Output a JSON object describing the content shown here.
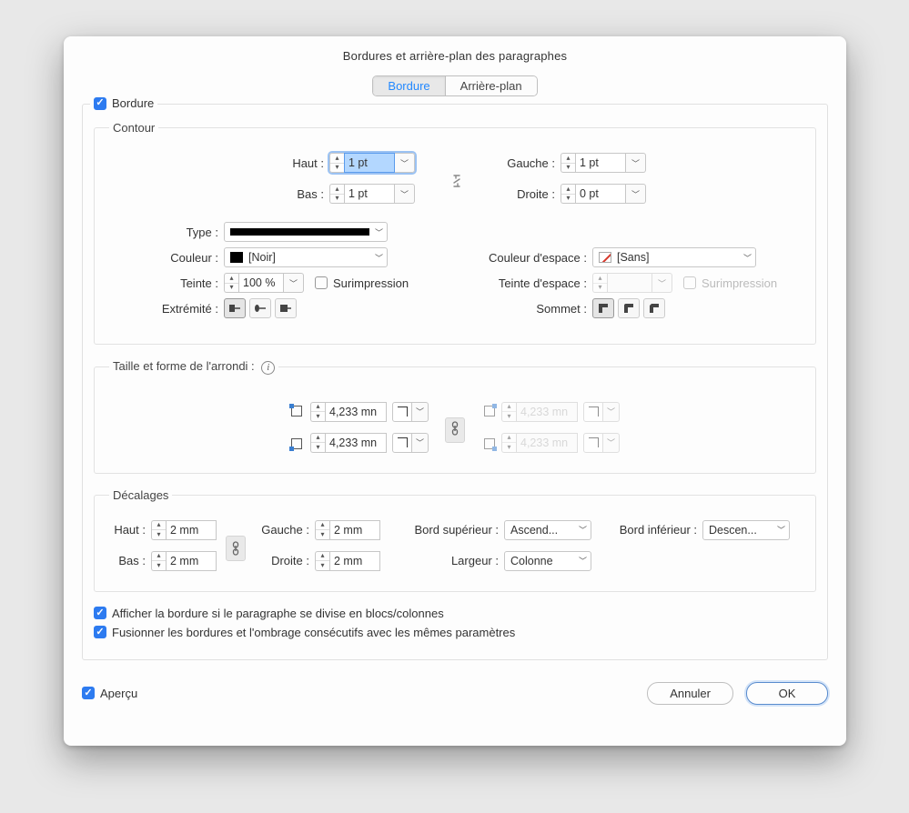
{
  "title": "Bordures et arrière-plan des paragraphes",
  "tabs": {
    "bordure": "Bordure",
    "arriere": "Arrière-plan"
  },
  "activeTab": "bordure",
  "bordureCheck": "Bordure",
  "section": {
    "contour": {
      "title": "Contour",
      "haut": {
        "label": "Haut :",
        "value": "1 pt"
      },
      "bas": {
        "label": "Bas :",
        "value": "1 pt"
      },
      "gauche": {
        "label": "Gauche :",
        "value": "1 pt"
      },
      "droite": {
        "label": "Droite :",
        "value": "0 pt"
      },
      "type": {
        "label": "Type :"
      },
      "couleur": {
        "label": "Couleur :",
        "value": "[Noir]"
      },
      "teinte": {
        "label": "Teinte :",
        "value": "100 %"
      },
      "surimp": "Surimpression",
      "couleurEspace": {
        "label": "Couleur d'espace :",
        "value": "[Sans]"
      },
      "teinteEspace": {
        "label": "Teinte d'espace :"
      },
      "surimp2": "Surimpression",
      "extremite": "Extrémité :",
      "sommet": "Sommet :"
    },
    "arrondi": {
      "title": "Taille et forme de l'arrondi :",
      "tl": "4,233 mn",
      "bl": "4,233 mn",
      "tr": "4,233 mn",
      "br": "4,233 mn"
    },
    "decalages": {
      "title": "Décalages",
      "haut": {
        "label": "Haut :",
        "value": "2 mm"
      },
      "bas": {
        "label": "Bas :",
        "value": "2 mm"
      },
      "gauche": {
        "label": "Gauche :",
        "value": "2 mm"
      },
      "droite": {
        "label": "Droite :",
        "value": "2 mm"
      },
      "bordSup": {
        "label": "Bord supérieur :",
        "value": "Ascend..."
      },
      "bordInf": {
        "label": "Bord inférieur :",
        "value": "Descen..."
      },
      "largeur": {
        "label": "Largeur :",
        "value": "Colonne"
      }
    },
    "opt1": "Afficher la bordure si le paragraphe se divise en blocs/colonnes",
    "opt2": "Fusionner les bordures et l'ombrage consécutifs avec les mêmes paramètres"
  },
  "apercu": "Aperçu",
  "buttons": {
    "cancel": "Annuler",
    "ok": "OK"
  }
}
